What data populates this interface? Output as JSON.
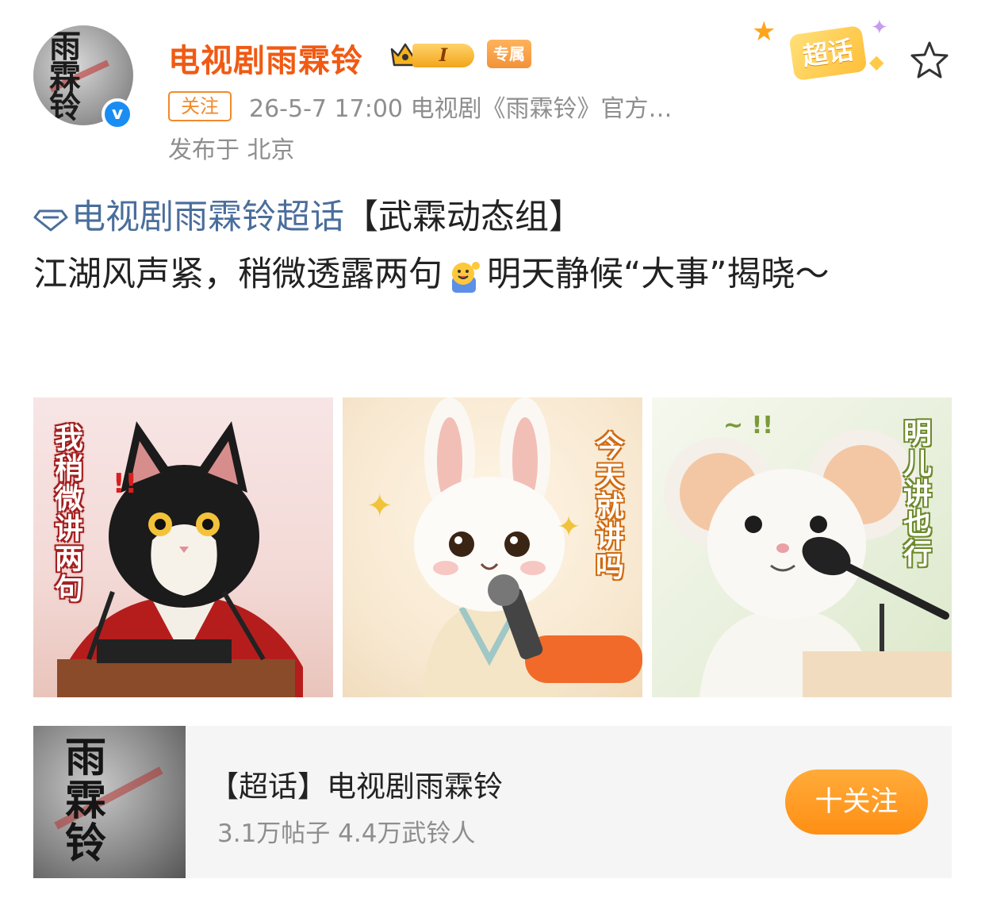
{
  "header": {
    "username": "电视剧雨霖铃",
    "level_badge": "I",
    "exclusive_badge": "专属",
    "follow_tag": "关注",
    "meta": "26-5-7 17:00 电视剧《雨霖铃》官方…",
    "location": "发布于 北京",
    "supertopic_badge": "超话",
    "avatar_text": "雨霖铃",
    "verify_mark": "v"
  },
  "post": {
    "topic_link": "电视剧雨霖铃超话",
    "group_tag": "【武霖动态组】",
    "text_before_emoji": "江湖风声紧，稍微透露两句",
    "text_after_emoji": "明天静候“大事”揭晓～"
  },
  "images": [
    {
      "caption": "我稍微讲两句",
      "subject": "cat"
    },
    {
      "caption": "今天就讲吗",
      "subject": "rabbit"
    },
    {
      "caption": "明儿讲也行",
      "subject": "mouse"
    }
  ],
  "topic_card": {
    "title": "【超话】电视剧雨霖铃",
    "stats": "3.1万帖子 4.4万武铃人",
    "follow_button": "十关注",
    "thumb_text": "雨霖铃"
  },
  "colors": {
    "username": "#f05a13",
    "topic_link": "#4a6e9c",
    "follow_button": "#ff9a1f",
    "verify": "#1a8df2"
  },
  "icons": {
    "verify": "verified-check-icon",
    "star": "star-outline-icon",
    "topic": "diamond-icon",
    "emoji": "waving-emoji-icon",
    "crown": "crown-icon"
  }
}
